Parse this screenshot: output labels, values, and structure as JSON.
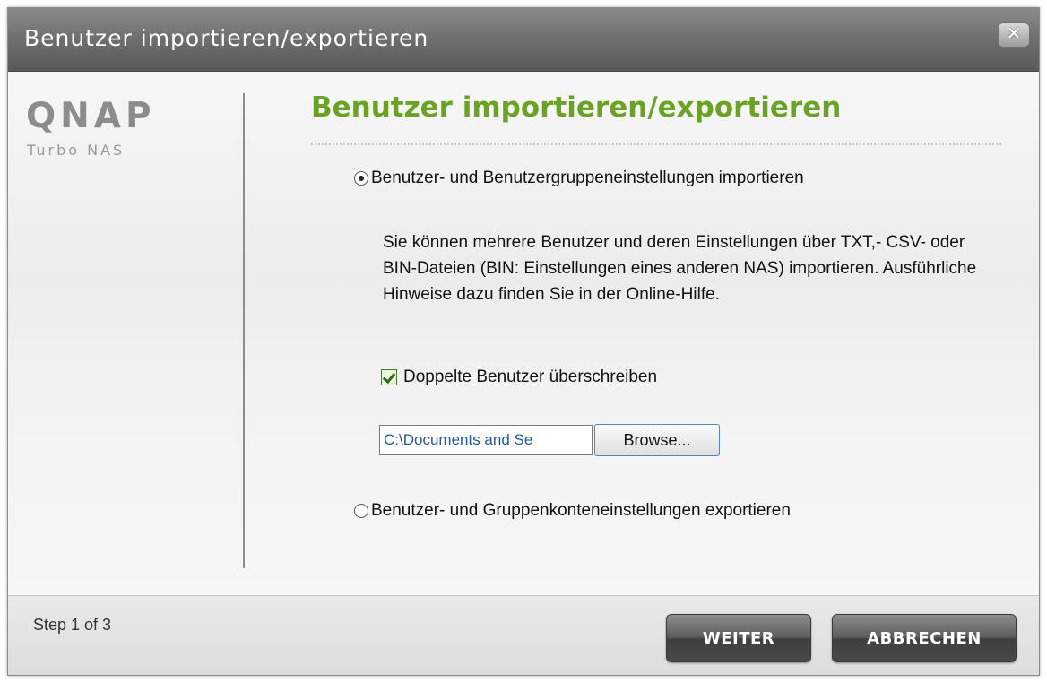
{
  "window": {
    "title": "Benutzer importieren/exportieren",
    "close_icon": "close-icon",
    "close_glyph": "✕"
  },
  "brand": {
    "logo": "QNAP",
    "sub": "Turbo NAS"
  },
  "main": {
    "heading": "Benutzer importieren/exportieren",
    "import_option": {
      "label": "Benutzer- und Benutzergruppeneinstellungen importieren",
      "selected": true
    },
    "description": "Sie können mehrere Benutzer und deren Einstellungen über TXT,- CSV- oder BIN-Dateien (BIN: Einstellungen eines anderen NAS) importieren. Ausführliche Hinweise dazu finden Sie in der Online-Hilfe.",
    "overwrite_checkbox": {
      "label": "Doppelte Benutzer überschreiben",
      "checked": true
    },
    "file_path": "C:\\Documents and Se",
    "browse_label": "Browse...",
    "export_option": {
      "label": "Benutzer- und Gruppenkonteneinstellungen exportieren",
      "selected": false
    }
  },
  "footer": {
    "step": "Step 1 of 3",
    "next_label": "WEITER",
    "cancel_label": "ABBRECHEN"
  },
  "colors": {
    "heading_green": "#6aa324",
    "titlebar": "#6e6e6e",
    "link_blue": "#245a9b"
  }
}
